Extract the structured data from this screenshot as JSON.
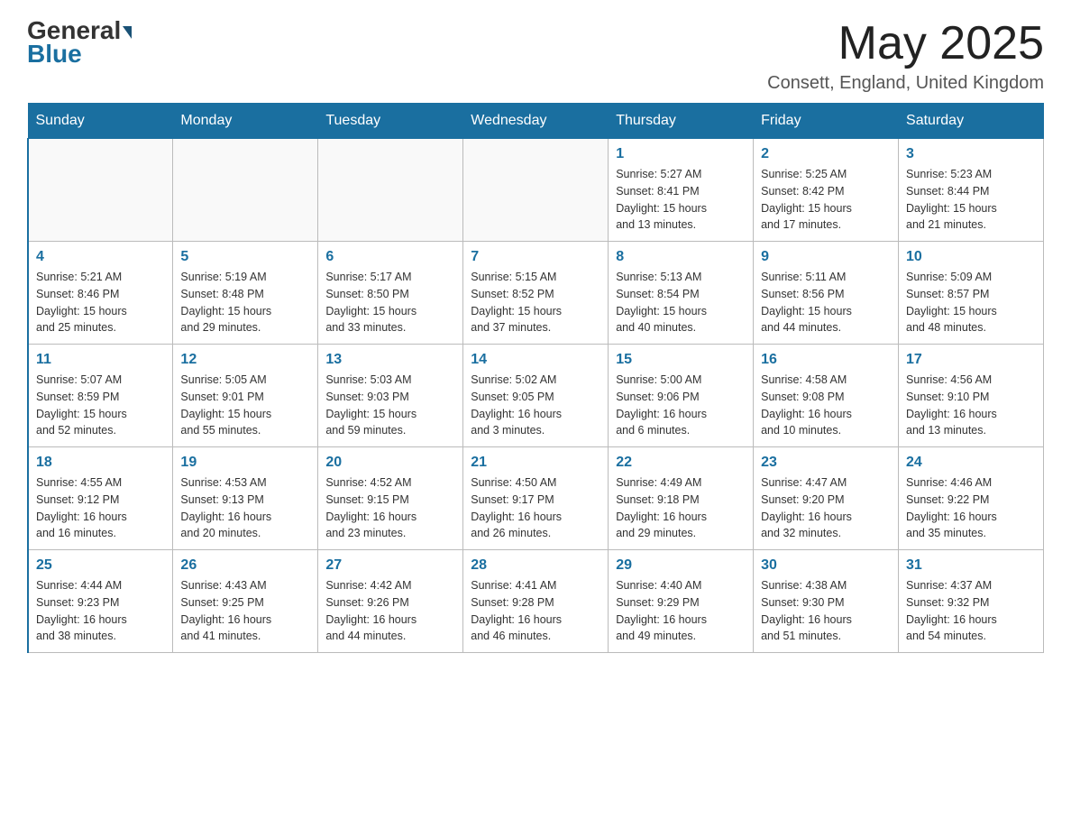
{
  "header": {
    "logo_general": "General",
    "logo_blue": "Blue",
    "month_year": "May 2025",
    "location": "Consett, England, United Kingdom"
  },
  "days_of_week": [
    "Sunday",
    "Monday",
    "Tuesday",
    "Wednesday",
    "Thursday",
    "Friday",
    "Saturday"
  ],
  "weeks": [
    [
      {
        "day": "",
        "info": ""
      },
      {
        "day": "",
        "info": ""
      },
      {
        "day": "",
        "info": ""
      },
      {
        "day": "",
        "info": ""
      },
      {
        "day": "1",
        "info": "Sunrise: 5:27 AM\nSunset: 8:41 PM\nDaylight: 15 hours\nand 13 minutes."
      },
      {
        "day": "2",
        "info": "Sunrise: 5:25 AM\nSunset: 8:42 PM\nDaylight: 15 hours\nand 17 minutes."
      },
      {
        "day": "3",
        "info": "Sunrise: 5:23 AM\nSunset: 8:44 PM\nDaylight: 15 hours\nand 21 minutes."
      }
    ],
    [
      {
        "day": "4",
        "info": "Sunrise: 5:21 AM\nSunset: 8:46 PM\nDaylight: 15 hours\nand 25 minutes."
      },
      {
        "day": "5",
        "info": "Sunrise: 5:19 AM\nSunset: 8:48 PM\nDaylight: 15 hours\nand 29 minutes."
      },
      {
        "day": "6",
        "info": "Sunrise: 5:17 AM\nSunset: 8:50 PM\nDaylight: 15 hours\nand 33 minutes."
      },
      {
        "day": "7",
        "info": "Sunrise: 5:15 AM\nSunset: 8:52 PM\nDaylight: 15 hours\nand 37 minutes."
      },
      {
        "day": "8",
        "info": "Sunrise: 5:13 AM\nSunset: 8:54 PM\nDaylight: 15 hours\nand 40 minutes."
      },
      {
        "day": "9",
        "info": "Sunrise: 5:11 AM\nSunset: 8:56 PM\nDaylight: 15 hours\nand 44 minutes."
      },
      {
        "day": "10",
        "info": "Sunrise: 5:09 AM\nSunset: 8:57 PM\nDaylight: 15 hours\nand 48 minutes."
      }
    ],
    [
      {
        "day": "11",
        "info": "Sunrise: 5:07 AM\nSunset: 8:59 PM\nDaylight: 15 hours\nand 52 minutes."
      },
      {
        "day": "12",
        "info": "Sunrise: 5:05 AM\nSunset: 9:01 PM\nDaylight: 15 hours\nand 55 minutes."
      },
      {
        "day": "13",
        "info": "Sunrise: 5:03 AM\nSunset: 9:03 PM\nDaylight: 15 hours\nand 59 minutes."
      },
      {
        "day": "14",
        "info": "Sunrise: 5:02 AM\nSunset: 9:05 PM\nDaylight: 16 hours\nand 3 minutes."
      },
      {
        "day": "15",
        "info": "Sunrise: 5:00 AM\nSunset: 9:06 PM\nDaylight: 16 hours\nand 6 minutes."
      },
      {
        "day": "16",
        "info": "Sunrise: 4:58 AM\nSunset: 9:08 PM\nDaylight: 16 hours\nand 10 minutes."
      },
      {
        "day": "17",
        "info": "Sunrise: 4:56 AM\nSunset: 9:10 PM\nDaylight: 16 hours\nand 13 minutes."
      }
    ],
    [
      {
        "day": "18",
        "info": "Sunrise: 4:55 AM\nSunset: 9:12 PM\nDaylight: 16 hours\nand 16 minutes."
      },
      {
        "day": "19",
        "info": "Sunrise: 4:53 AM\nSunset: 9:13 PM\nDaylight: 16 hours\nand 20 minutes."
      },
      {
        "day": "20",
        "info": "Sunrise: 4:52 AM\nSunset: 9:15 PM\nDaylight: 16 hours\nand 23 minutes."
      },
      {
        "day": "21",
        "info": "Sunrise: 4:50 AM\nSunset: 9:17 PM\nDaylight: 16 hours\nand 26 minutes."
      },
      {
        "day": "22",
        "info": "Sunrise: 4:49 AM\nSunset: 9:18 PM\nDaylight: 16 hours\nand 29 minutes."
      },
      {
        "day": "23",
        "info": "Sunrise: 4:47 AM\nSunset: 9:20 PM\nDaylight: 16 hours\nand 32 minutes."
      },
      {
        "day": "24",
        "info": "Sunrise: 4:46 AM\nSunset: 9:22 PM\nDaylight: 16 hours\nand 35 minutes."
      }
    ],
    [
      {
        "day": "25",
        "info": "Sunrise: 4:44 AM\nSunset: 9:23 PM\nDaylight: 16 hours\nand 38 minutes."
      },
      {
        "day": "26",
        "info": "Sunrise: 4:43 AM\nSunset: 9:25 PM\nDaylight: 16 hours\nand 41 minutes."
      },
      {
        "day": "27",
        "info": "Sunrise: 4:42 AM\nSunset: 9:26 PM\nDaylight: 16 hours\nand 44 minutes."
      },
      {
        "day": "28",
        "info": "Sunrise: 4:41 AM\nSunset: 9:28 PM\nDaylight: 16 hours\nand 46 minutes."
      },
      {
        "day": "29",
        "info": "Sunrise: 4:40 AM\nSunset: 9:29 PM\nDaylight: 16 hours\nand 49 minutes."
      },
      {
        "day": "30",
        "info": "Sunrise: 4:38 AM\nSunset: 9:30 PM\nDaylight: 16 hours\nand 51 minutes."
      },
      {
        "day": "31",
        "info": "Sunrise: 4:37 AM\nSunset: 9:32 PM\nDaylight: 16 hours\nand 54 minutes."
      }
    ]
  ]
}
